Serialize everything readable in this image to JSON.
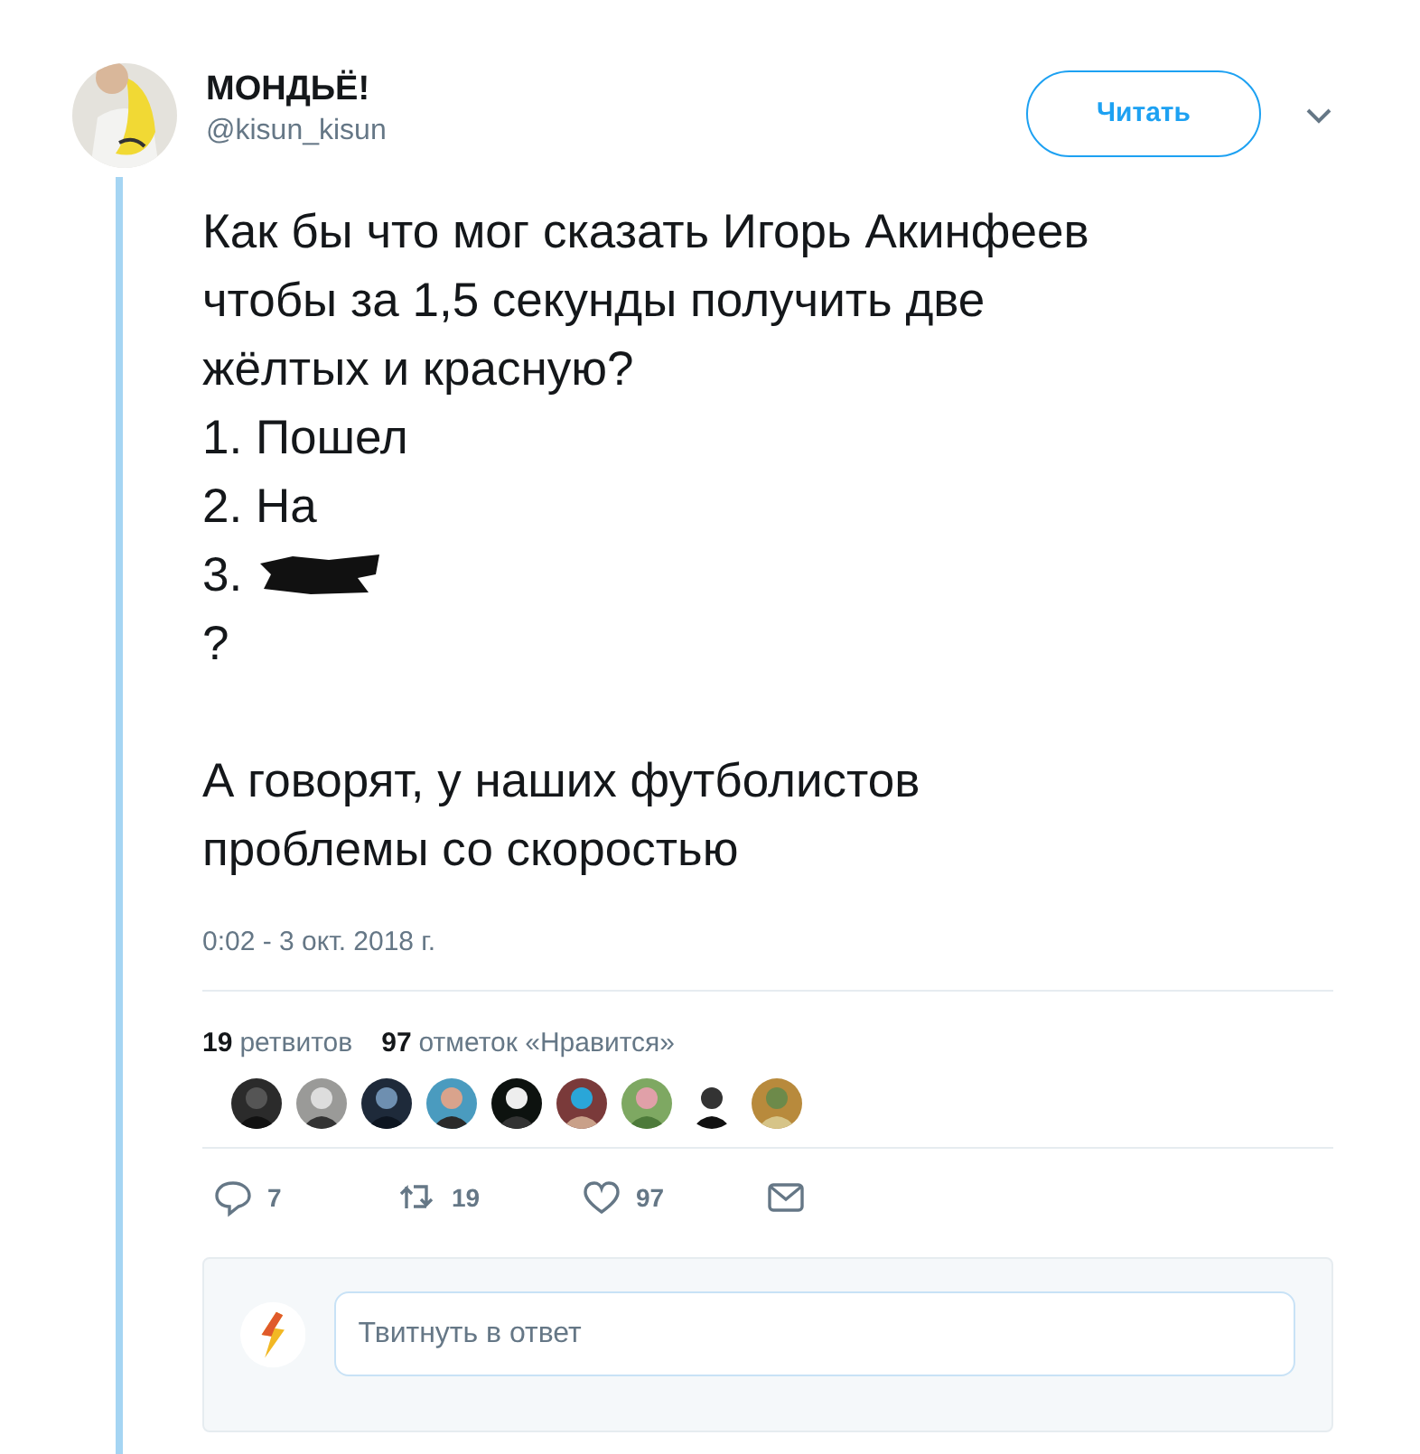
{
  "author": {
    "name": "МОНДЬЁ!",
    "handle": "@kisun_kisun"
  },
  "follow_button": "Читать",
  "tweet": {
    "paragraphs": [
      [
        {
          "text": "Как бы что мог сказать Игорь Акинфеев чтобы за 1,5 секунды получить две жёлтых и красную?"
        },
        {
          "text": "1. Пошел"
        },
        {
          "text": "2. На"
        },
        {
          "text": "3.",
          "redacted": true
        },
        {
          "text": "?"
        }
      ],
      [
        {
          "text": "А говорят, у наших футболистов проблемы со скоростью"
        }
      ]
    ]
  },
  "timestamp": "0:02 - 3 окт. 2018 г.",
  "stats": [
    {
      "count": "19",
      "label": "ретвитов"
    },
    {
      "count": "97",
      "label": "отметок «Нравится»"
    }
  ],
  "actions": [
    {
      "kind": "reply",
      "count": "7"
    },
    {
      "kind": "retweet",
      "count": "19"
    },
    {
      "kind": "like",
      "count": "97"
    },
    {
      "kind": "message"
    }
  ],
  "reply_box": {
    "placeholder": "Твитнуть в ответ"
  }
}
